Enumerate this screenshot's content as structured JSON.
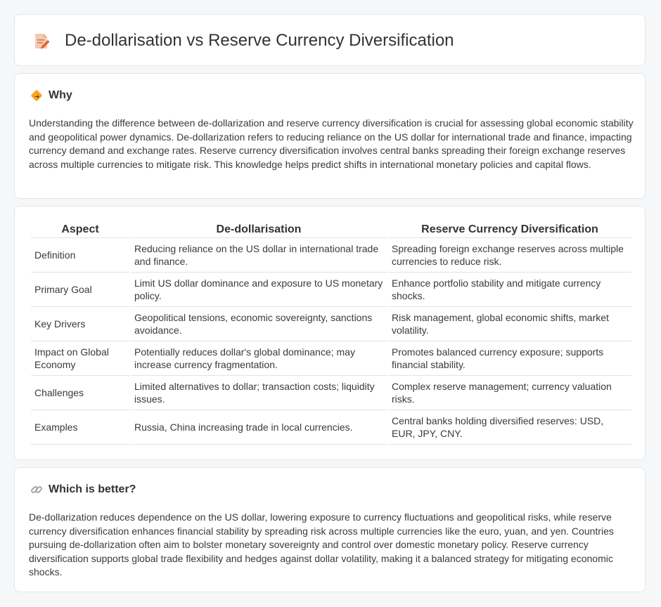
{
  "header": {
    "title": "De-dollarisation vs Reserve Currency Diversification",
    "icon": "document-pen-icon"
  },
  "why": {
    "heading": "Why",
    "icon": "diamond-arrow-icon",
    "text": "Understanding the difference between de-dollarization and reserve currency diversification is crucial for assessing global economic stability and geopolitical power dynamics. De-dollarization refers to reducing reliance on the US dollar for international trade and finance, impacting currency demand and exchange rates. Reserve currency diversification involves central banks spreading their foreign exchange reserves across multiple currencies to mitigate risk. This knowledge helps predict shifts in international monetary policies and capital flows."
  },
  "comparison": {
    "columns": [
      "Aspect",
      "De-dollarisation",
      "Reserve Currency Diversification"
    ],
    "rows": [
      [
        "Definition",
        "Reducing reliance on the US dollar in international trade and finance.",
        "Spreading foreign exchange reserves across multiple currencies to reduce risk."
      ],
      [
        "Primary Goal",
        "Limit US dollar dominance and exposure to US monetary policy.",
        "Enhance portfolio stability and mitigate currency shocks."
      ],
      [
        "Key Drivers",
        "Geopolitical tensions, economic sovereignty, sanctions avoidance.",
        "Risk management, global economic shifts, market volatility."
      ],
      [
        "Impact on Global Economy",
        "Potentially reduces dollar's global dominance; may increase currency fragmentation.",
        "Promotes balanced currency exposure; supports financial stability."
      ],
      [
        "Challenges",
        "Limited alternatives to dollar; transaction costs; liquidity issues.",
        "Complex reserve management; currency valuation risks."
      ],
      [
        "Examples",
        "Russia, China increasing trade in local currencies.",
        "Central banks holding diversified reserves: USD, EUR, JPY, CNY."
      ]
    ]
  },
  "better": {
    "heading": "Which is better?",
    "icon": "link-icon",
    "text": "De-dollarization reduces dependence on the US dollar, lowering exposure to currency fluctuations and geopolitical risks, while reserve currency diversification enhances financial stability by spreading risk across multiple currencies like the euro, yuan, and yen. Countries pursuing de-dollarization often aim to bolster monetary sovereignty and control over domestic monetary policy. Reserve currency diversification supports global trade flexibility and hedges against dollar volatility, making it a balanced strategy for mitigating economic shocks."
  }
}
